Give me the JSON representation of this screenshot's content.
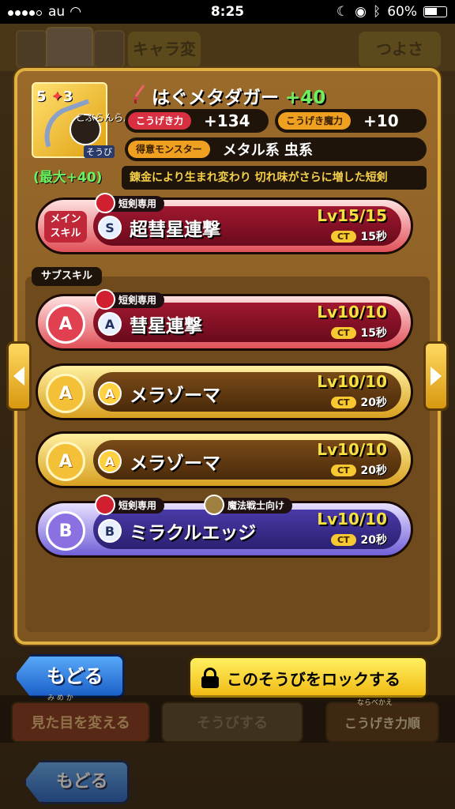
{
  "status_bar": {
    "carrier": "au",
    "time": "8:25",
    "battery": "60%"
  },
  "background": {
    "chara_change_label": "キャラ変更",
    "tsuyosa_label": "つよさ",
    "look_change_label": "見た目を変える",
    "look_change_ruby": "み め か",
    "equip_label": "そうびする",
    "sort_label": "こうげき力順",
    "sort_ruby": "ならべかえ",
    "back_label": "もどる"
  },
  "weapon": {
    "stars": "5",
    "plus_level": "3",
    "owner": "こぶらんらん",
    "equipped_label": "そうび",
    "max_label": "(最大+40)",
    "name": "はぐメタダガー",
    "plus_value": "+40",
    "attack_label": "こうげき力",
    "attack_value": "+134",
    "magic_label": "こうげき魔力",
    "magic_value": "+10",
    "monster_label": "得意モンスター",
    "monster_value": "メタル系 虫系",
    "description": "錬金により生まれ変わり 切れ味がさらに増した短剣"
  },
  "main_skill": {
    "section_label": "メイン スキル",
    "restriction": "短剣専用",
    "rank_badge": "S",
    "name": "超彗星連撃",
    "level": "Lv15/15",
    "ct_label": "CT",
    "ct_value": "15秒"
  },
  "sub_skill_label": "サブスキル",
  "sub_skills": [
    {
      "rank": "A",
      "small_rank": "A",
      "restriction": "短剣専用",
      "name": "彗星連撃",
      "level": "Lv10/10",
      "ct_label": "CT",
      "ct_value": "15秒"
    },
    {
      "rank": "A",
      "small_rank": "A",
      "name": "メラゾーマ",
      "level": "Lv10/10",
      "ct_label": "CT",
      "ct_value": "20秒"
    },
    {
      "rank": "A",
      "small_rank": "A",
      "name": "メラゾーマ",
      "level": "Lv10/10",
      "ct_label": "CT",
      "ct_value": "20秒"
    },
    {
      "rank": "B",
      "small_rank": "B",
      "restriction": "短剣専用",
      "restriction2": "魔法戦士向け",
      "name": "ミラクルエッジ",
      "level": "Lv10/10",
      "ct_label": "CT",
      "ct_value": "20秒"
    }
  ],
  "buttons": {
    "back": "もどる",
    "lock": "このそうびをロックする"
  },
  "colors": {
    "accent_gold": "#e0b040",
    "green_plus": "#6cf060",
    "level_yellow": "#f6e040"
  }
}
